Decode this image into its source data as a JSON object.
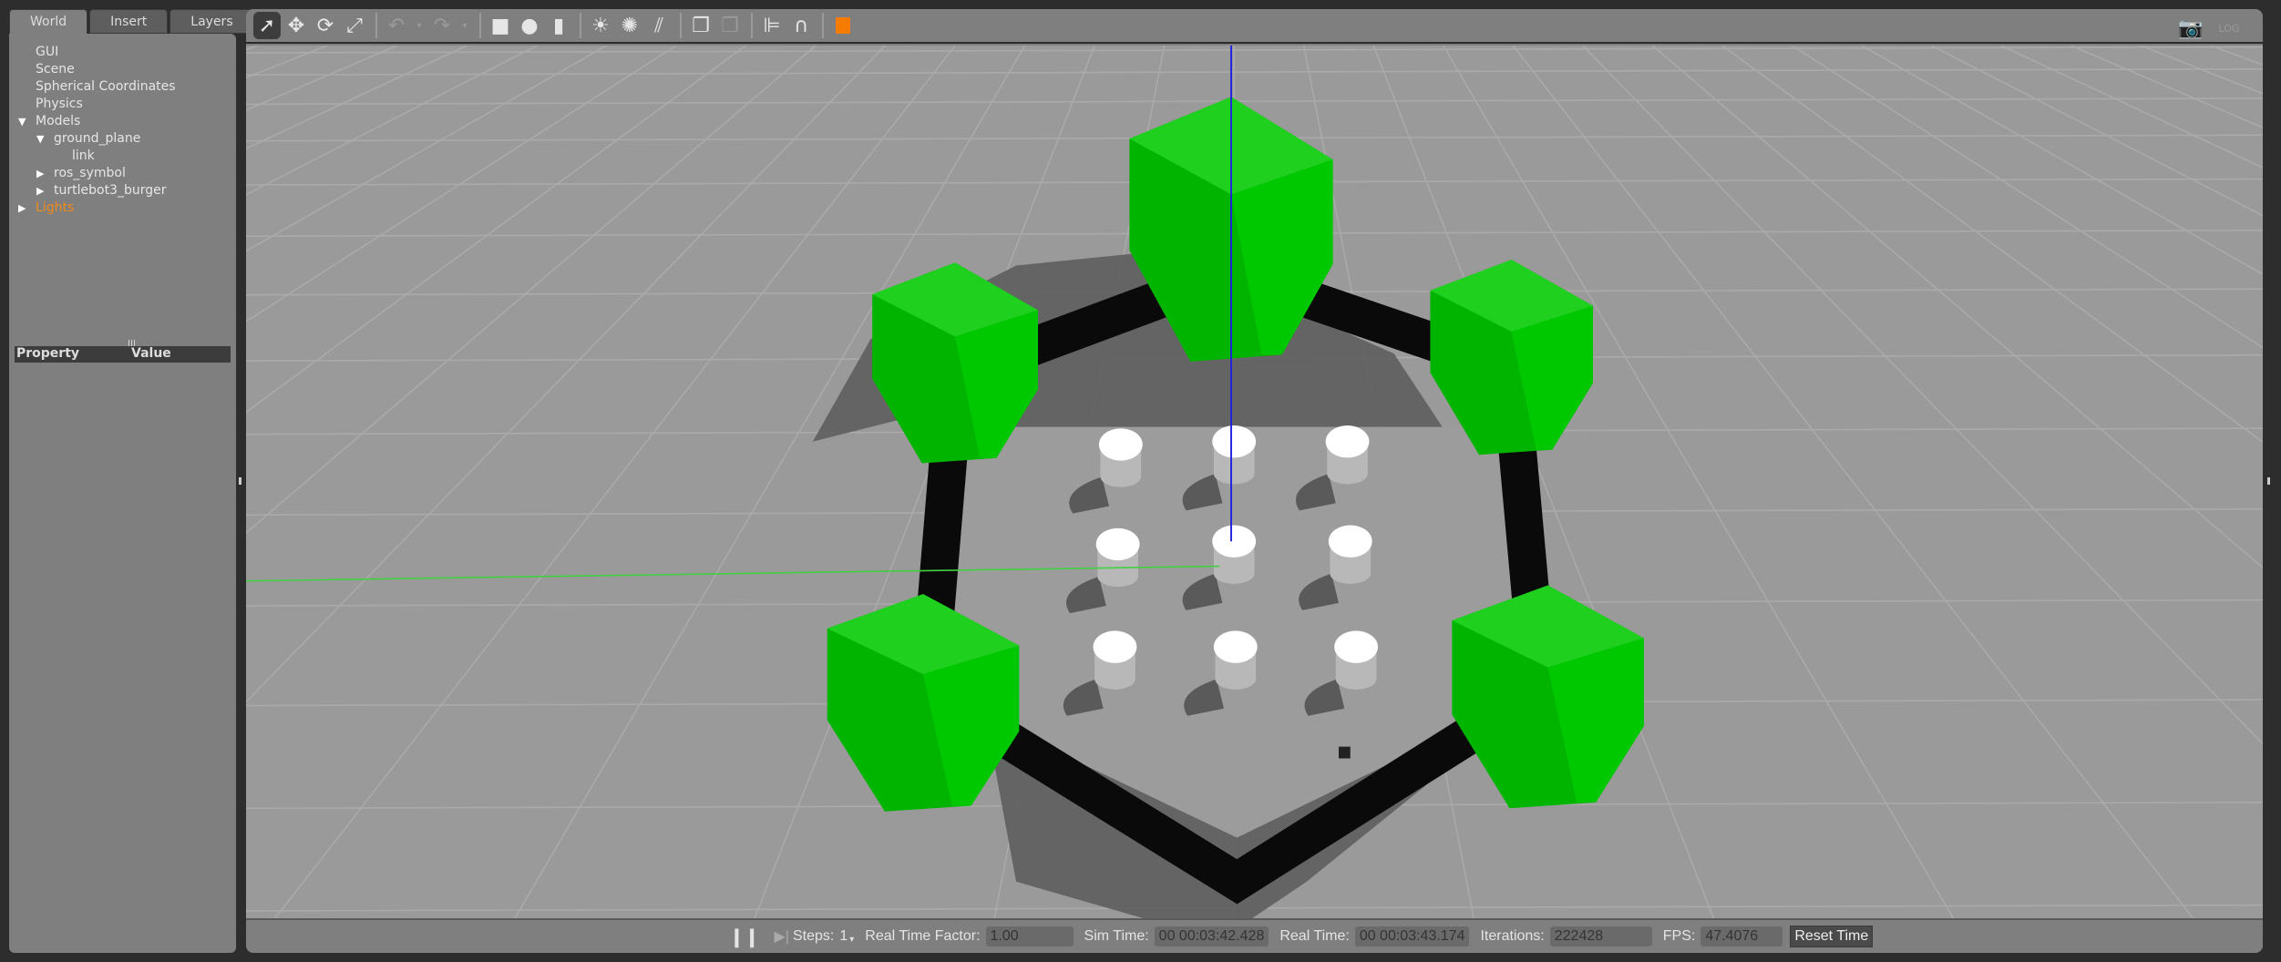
{
  "tabs": [
    "World",
    "Insert",
    "Layers"
  ],
  "tree": [
    {
      "label": "GUI",
      "depth": 0,
      "arrow": ""
    },
    {
      "label": "Scene",
      "depth": 0,
      "arrow": ""
    },
    {
      "label": "Spherical Coordinates",
      "depth": 0,
      "arrow": ""
    },
    {
      "label": "Physics",
      "depth": 0,
      "arrow": ""
    },
    {
      "label": "Models",
      "depth": 0,
      "arrow": "down"
    },
    {
      "label": "ground_plane",
      "depth": 1,
      "arrow": "down"
    },
    {
      "label": "link",
      "depth": 2,
      "arrow": ""
    },
    {
      "label": "ros_symbol",
      "depth": 1,
      "arrow": "right"
    },
    {
      "label": "turtlebot3_burger",
      "depth": 1,
      "arrow": "right"
    },
    {
      "label": "Lights",
      "depth": 0,
      "arrow": "right",
      "highlight": true
    }
  ],
  "properties": {
    "col1": "Property",
    "col2": "Value"
  },
  "toolbar": {
    "icons": [
      "select-arrow-icon",
      "translate-icon",
      "rotate-icon",
      "scale-icon",
      "undo-icon",
      "undo-dropdown-icon",
      "redo-icon",
      "redo-dropdown-icon",
      "box-icon",
      "sphere-icon",
      "cylinder-icon",
      "point-light-icon",
      "spot-light-icon",
      "directional-light-icon",
      "copy-icon",
      "paste-icon",
      "align-icon",
      "snap-icon",
      "view-angle-icon"
    ],
    "right_icons": [
      "screenshot-camera-icon",
      "log-download-icon"
    ]
  },
  "bottom": {
    "steps_label": "Steps:",
    "steps_value": "1",
    "rtf_label": "Real Time Factor:",
    "rtf_value": "1.00",
    "sim_label": "Sim Time:",
    "sim_value": "00 00:03:42.428",
    "real_label": "Real Time:",
    "real_value": "00 00:03:43.174",
    "iter_label": "Iterations:",
    "iter_value": "222428",
    "fps_label": "FPS:",
    "fps_value": "47.4076",
    "reset_label": "Reset Time"
  },
  "colors": {
    "accent": "#f08a1c",
    "pillar": "#00c800",
    "ground": "#9a9a9a"
  }
}
